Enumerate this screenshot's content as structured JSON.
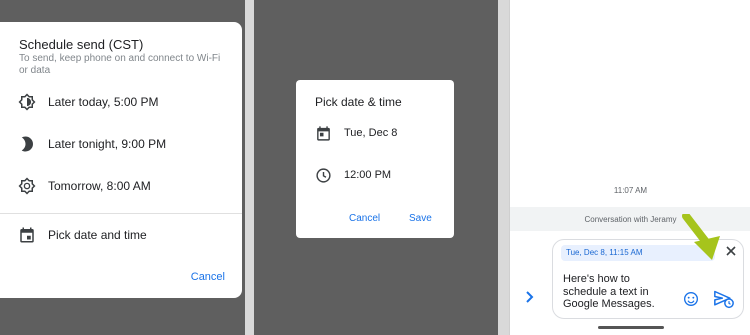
{
  "schedule_sheet": {
    "title": "Schedule send (CST)",
    "subtitle": "To send, keep phone on and connect to Wi-Fi or data",
    "options": [
      {
        "label": "Later today, 5:00 PM",
        "icon": "brightness-icon"
      },
      {
        "label": "Later tonight, 9:00 PM",
        "icon": "moon-icon"
      },
      {
        "label": "Tomorrow, 8:00 AM",
        "icon": "sun-icon"
      },
      {
        "label": "Pick date and time",
        "icon": "calendar-icon"
      }
    ],
    "cancel_label": "Cancel"
  },
  "picker_dialog": {
    "title": "Pick date & time",
    "date_value": "Tue, Dec 8",
    "time_value": "12:00 PM",
    "cancel_label": "Cancel",
    "save_label": "Save"
  },
  "conversation": {
    "timestamp": "11:07 AM",
    "header": "Conversation with Jeramy",
    "scheduled_chip": "Tue, Dec 8, 11:15 AM",
    "message_text": "Here's how to schedule a text in Google Messages.",
    "accent_color": "#1a73e8",
    "arrow_color": "#a6c41c"
  }
}
